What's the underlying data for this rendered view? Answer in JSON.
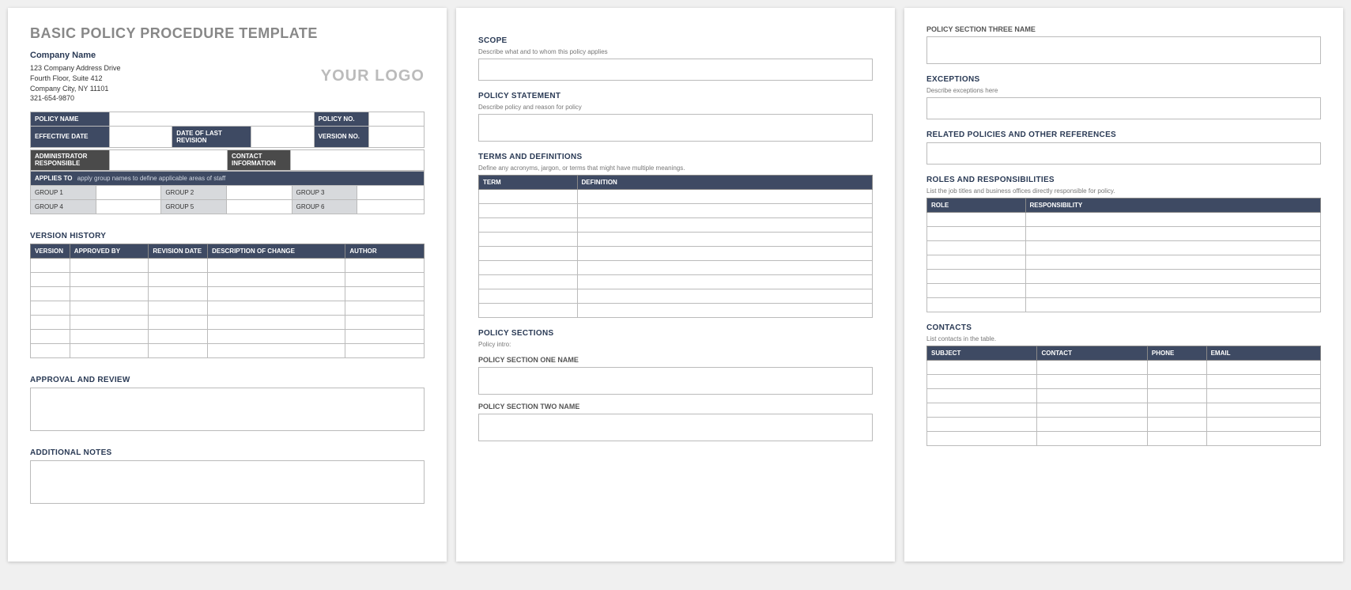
{
  "page1": {
    "title": "BASIC POLICY PROCEDURE TEMPLATE",
    "company": {
      "name": "Company Name",
      "addr1": "123 Company Address Drive",
      "addr2": "Fourth Floor, Suite 412",
      "addr3": "Company City, NY  11101",
      "phone": "321-654-9870"
    },
    "logo": "YOUR LOGO",
    "meta": {
      "policyNameLabel": "POLICY NAME",
      "policyNoLabel": "POLICY NO.",
      "effDateLabel": "EFFECTIVE DATE",
      "lastRevLabel": "DATE OF LAST REVISION",
      "versionNoLabel": "VERSION NO.",
      "adminLabel": "ADMINISTRATOR RESPONSIBLE",
      "contactLabel": "CONTACT INFORMATION",
      "appliesLabel": "APPLIES TO",
      "appliesDesc": "apply group names to define applicable areas of staff",
      "groups": [
        "GROUP 1",
        "GROUP 2",
        "GROUP 3",
        "GROUP 4",
        "GROUP 5",
        "GROUP 6"
      ]
    },
    "versionHistory": {
      "title": "VERSION HISTORY",
      "cols": [
        "VERSION",
        "APPROVED BY",
        "REVISION DATE",
        "DESCRIPTION OF CHANGE",
        "AUTHOR"
      ]
    },
    "approval": "APPROVAL AND REVIEW",
    "notes": "ADDITIONAL NOTES"
  },
  "page2": {
    "scope": {
      "title": "SCOPE",
      "desc": "Describe what and to whom this policy applies"
    },
    "statement": {
      "title": "POLICY STATEMENT",
      "desc": "Describe policy and reason for policy"
    },
    "terms": {
      "title": "TERMS AND DEFINITIONS",
      "desc": "Define any acronyms, jargon, or terms that might have multiple meanings.",
      "cols": [
        "TERM",
        "DEFINITION"
      ]
    },
    "sections": {
      "title": "POLICY SECTIONS",
      "intro": "Policy intro:",
      "s1": "POLICY SECTION ONE NAME",
      "s2": "POLICY SECTION TWO NAME"
    }
  },
  "page3": {
    "s3": "POLICY SECTION THREE NAME",
    "exceptions": {
      "title": "EXCEPTIONS",
      "desc": "Describe exceptions here"
    },
    "related": "RELATED POLICIES AND OTHER REFERENCES",
    "roles": {
      "title": "ROLES AND RESPONSIBILITIES",
      "desc": "List the job titles and business offices directly responsible for policy.",
      "cols": [
        "ROLE",
        "RESPONSIBILITY"
      ]
    },
    "contacts": {
      "title": "CONTACTS",
      "desc": "List contacts in the table.",
      "cols": [
        "SUBJECT",
        "CONTACT",
        "PHONE",
        "EMAIL"
      ]
    }
  }
}
